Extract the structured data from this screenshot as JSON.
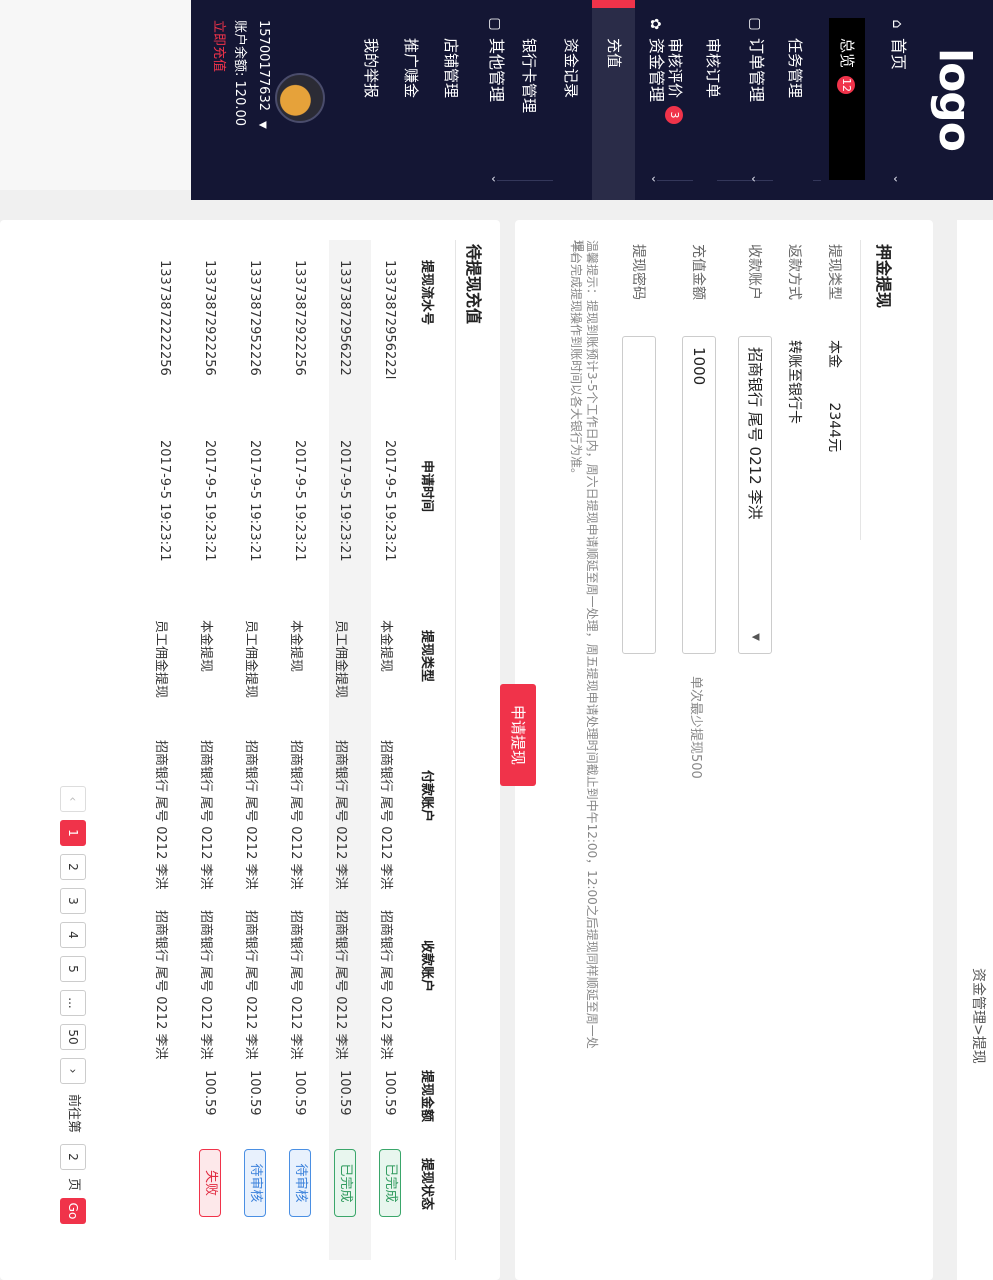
{
  "logo": "logo",
  "nav": {
    "home": "首页",
    "overview": "总览",
    "overview_badge": "12",
    "task_mgmt": "任务管理",
    "order_mgmt": "订单管理",
    "review_order": "审核订单",
    "review_eval": "审核评价",
    "review_eval_badge": "3",
    "fund_mgmt": "资金管理",
    "recharge": "充值",
    "fund_records": "资金记录",
    "bankcard_mgmt": "银行卡管理",
    "other_mgmt": "其他管理",
    "shop_mgmt": "店铺管理",
    "promo_earn": "推广赚金",
    "my_reports": "我的举报"
  },
  "account": {
    "phone": "15700177632",
    "balance_label": "账户余额:",
    "balance": "120.00",
    "recharge_link": "立即充值"
  },
  "breadcrumb": "资金管理>提现",
  "withdraw": {
    "title": "押金提现",
    "type_label": "提现类型",
    "type_value": "本金",
    "type_amount": "2344元",
    "return_label": "返款方式",
    "return_value": "转账至银行卡",
    "account_label": "收款账户",
    "account_value": "招商银行 尾号 0212 李洪",
    "amount_label": "充值金额",
    "amount_value": "1000",
    "amount_hint": "单次最少提现500",
    "password_label": "提现密码",
    "password_value": "",
    "notice1": "温馨提示：提现到账预计3-5个工作日内，周六日提现申请顺延至周一处理，周五提现申请处理时间截止到中午12:00，12:00之后提现同样顺延至周一处理。",
    "notice2": "平台完成提现操作到账时间以各大银行为准。",
    "submit": "申请提现"
  },
  "pending": {
    "title": "待提现充值",
    "columns": [
      "提现流水号",
      "申请时间",
      "提现类型",
      "付款账户",
      "收款账户",
      "提现金额",
      "提现状态"
    ],
    "rows": [
      {
        "serial": "13373872956222l",
        "time": "2017-9-5 19:23:21",
        "type": "本金提现",
        "pay": "招商银行 尾号 0212 李洪",
        "recv": "招商银行 尾号 0212 李洪",
        "amount": "100.59",
        "status": "已完成"
      },
      {
        "serial": "13373872956222",
        "time": "2017-9-5 19:23:21",
        "type": "员工佣金提现",
        "pay": "招商银行 尾号 0212 李洪",
        "recv": "招商银行 尾号 0212 李洪",
        "amount": "100.59",
        "status": "已完成"
      },
      {
        "serial": "13373872922256",
        "time": "2017-9-5 19:23:21",
        "type": "本金提现",
        "pay": "招商银行 尾号 0212 李洪",
        "recv": "招商银行 尾号 0212 李洪",
        "amount": "100.59",
        "status": "待审核"
      },
      {
        "serial": "13373872952226",
        "time": "2017-9-5 19:23:21",
        "type": "员工佣金提现",
        "pay": "招商银行 尾号 0212 李洪",
        "recv": "招商银行 尾号 0212 李洪",
        "amount": "100.59",
        "status": "待审核"
      },
      {
        "serial": "13373872922256",
        "time": "2017-9-5 19:23:21",
        "type": "本金提现",
        "pay": "招商银行 尾号 0212 李洪",
        "recv": "招商银行 尾号 0212 李洪",
        "amount": "100.59",
        "status": "失败"
      },
      {
        "serial": "13373872222256",
        "time": "2017-9-5 19:23:21",
        "type": "员工佣金提现",
        "pay": "招商银行 尾号 0212 李洪",
        "recv": "招商银行 尾号 0212 李洪",
        "amount": "",
        "status": ""
      }
    ]
  },
  "pagination": {
    "prev": "‹",
    "pages": [
      "1",
      "2",
      "3",
      "4",
      "5",
      "...",
      "50"
    ],
    "next": "›",
    "goto_prefix": "前往第",
    "goto_value": "2",
    "goto_suffix": "页",
    "go": "Go"
  },
  "colors": {
    "sidebar": "#141634",
    "accent": "#f0334a"
  }
}
